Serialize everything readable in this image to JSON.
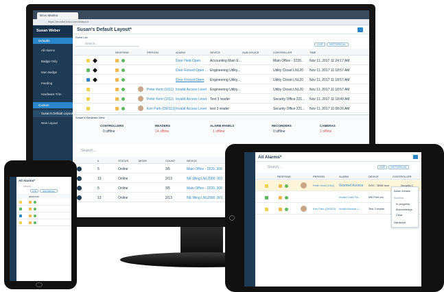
{
  "colors": {
    "sidebar": "#1f3b53",
    "accent": "#2a86c8",
    "green": "#5cb85c",
    "red": "#d9534f",
    "yellow": "#f0d34a"
  },
  "browser": {
    "tab_title": "Brivo Monitor",
    "url": "https://monitor.brivo.com/#/layout"
  },
  "sidebar": {
    "user": "Susan Weber",
    "defaults_label": "Defaults",
    "items": [
      "All Alarms",
      "Badge Only",
      "Man Badge",
      "Feeding",
      "Hardware Trim"
    ],
    "custom_label": "Custom",
    "active_layout": "Susan's Default Layout",
    "new_layout": "New Layout"
  },
  "header": {
    "title": "Susan's Default Layout*",
    "event_list_tab": "Event List",
    "search_placeholder": "Search...",
    "live_btn": "LIVE",
    "historical_btn": "HISTORICAL"
  },
  "alarm_table": {
    "columns": [
      "RESPOND",
      "PERSON",
      "ALARM",
      "DEVICE",
      "SUB-DEVICE",
      "CONTROLLER",
      "TIME"
    ],
    "rows": [
      {
        "person": "",
        "alarm": "Door Held Open",
        "device": "Accounting Main E...",
        "controller": "Main Office - 2220..",
        "time": "Nov 11, 2017 11:24:17 AM"
      },
      {
        "person": "",
        "alarm": "Door Forced Open ...",
        "device": "Engineering Utility...",
        "controller": "Utility Closet LNL20",
        "time": "Nov 11, 2017 11:18:57 AM"
      },
      {
        "person": "",
        "alarm": "Door Forced Open",
        "device": "Engineering Utility...",
        "controller": "Utility Closet LNL20",
        "time": "Nov 11, 2017 11:18:57 AM"
      },
      {
        "person": "Peter Kent (1011)",
        "alarm": "Invalid Access Level",
        "device": "Engineering Utility...",
        "controller": "Utility Closet LNL20",
        "time": "Nov 11, 2017 11:18:57 AM"
      },
      {
        "person": "Peter Kent (1011)",
        "alarm": "Invalid Access Level",
        "device": "Test 3 reader",
        "controller": "Security Office 221...",
        "time": "Nov 11, 2017 11:18:49 AM"
      },
      {
        "person": "Ken Park (250113)",
        "alarm": "Invalid Access Level",
        "device": "test 3 reader",
        "controller": "Security Office 221...",
        "time": "Nov 11, 2017 11:08:26 AM"
      }
    ]
  },
  "hardware": {
    "tab": "Susan's Hardware View",
    "summaries": [
      {
        "label": "CONTROLLERS",
        "status": "0 offline"
      },
      {
        "label": "READERS",
        "status": "14 offline"
      },
      {
        "label": "ALARM PANELS",
        "status": "1 offline"
      },
      {
        "label": "RECORDERS",
        "status": "0 offline"
      },
      {
        "label": "CAMERAS",
        "status": "2 offline"
      }
    ],
    "search_placeholder": "Search...",
    "columns": [
      "#",
      "STATUS",
      "MODE",
      "COUNT",
      "DEVICE"
    ],
    "rows": [
      {
        "num": "5",
        "status": "Online",
        "count": "3/5",
        "device": "Main Office - 2220..300"
      },
      {
        "num": "13",
        "status": "Online",
        "count": "2/13",
        "device": "NE Wing LNL2000 .001"
      },
      {
        "num": "5",
        "status": "Online",
        "count": "3/5",
        "device": "Main Office - 2220..300"
      },
      {
        "num": "13",
        "status": "Online",
        "count": "2/13",
        "device": "NE Wing LNL2000 .001"
      }
    ]
  },
  "tablet": {
    "title": "All Alarms*",
    "search_placeholder": "Search...",
    "live_btn": "LIVE",
    "historical_btn": "HISTORICAL",
    "columns": [
      "RESPOND",
      "PERSON",
      "ALARM",
      "DEVICE",
      "CONTROLLER"
    ],
    "rows": [
      {
        "person": "Peter Kent (1011)",
        "alarm": "Granted Access",
        "device": "DOC - BDM door",
        "controller": "Security C"
      },
      {
        "person": "",
        "alarm": "Invalid Card Fm...",
        "device": "MB Print pm",
        "controller": ""
      },
      {
        "person": "Ken Park (250113)",
        "alarm": "Invalid Access L...",
        "device": "Test 3 reader",
        "controller": ""
      }
    ],
    "menu": {
      "header": "Alarm Details",
      "section": "Workflow",
      "items": [
        "In progress",
        "Acknowledge",
        "Clear"
      ],
      "footer": "Hardware"
    }
  },
  "phone": {
    "title": "All Alarms*",
    "search_placeholder": "Search...",
    "live_btn": "LIVE",
    "historical_btn": "HISTORICAL",
    "respond_col": "RESPOND"
  }
}
